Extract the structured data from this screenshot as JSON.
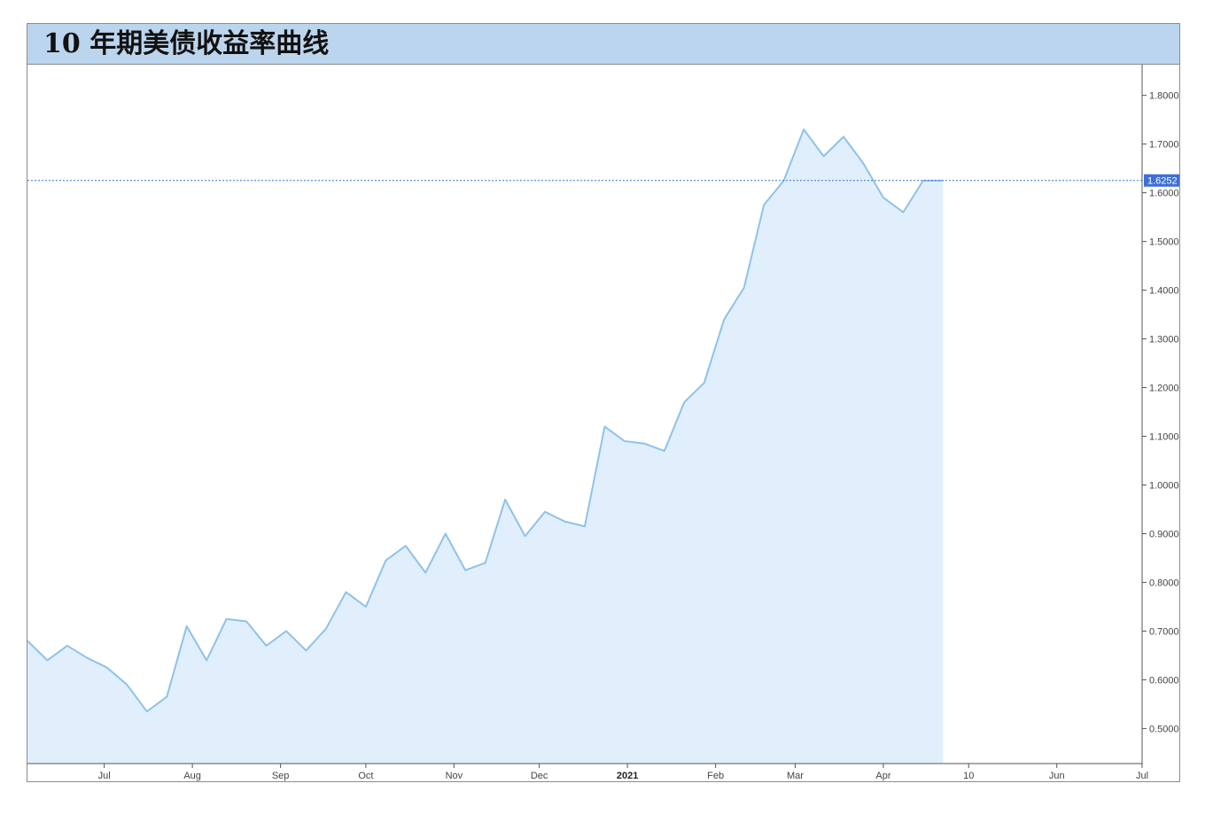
{
  "chart_data": {
    "type": "area",
    "title": "10 年期美债收益率曲线",
    "xlabel": "",
    "ylabel": "",
    "x_ticks": [
      {
        "label": "Jul",
        "date": "2020-07-01",
        "bold": false
      },
      {
        "label": "Aug",
        "date": "2020-08-01",
        "bold": false
      },
      {
        "label": "Sep",
        "date": "2020-09-01",
        "bold": false
      },
      {
        "label": "Oct",
        "date": "2020-10-01",
        "bold": false
      },
      {
        "label": "Nov",
        "date": "2020-11-01",
        "bold": false
      },
      {
        "label": "Dec",
        "date": "2020-12-01",
        "bold": false
      },
      {
        "label": "2021",
        "date": "2021-01-01",
        "bold": true
      },
      {
        "label": "Feb",
        "date": "2021-02-01",
        "bold": false
      },
      {
        "label": "Mar",
        "date": "2021-03-01",
        "bold": false
      },
      {
        "label": "Apr",
        "date": "2021-04-01",
        "bold": false
      },
      {
        "label": "10",
        "date": "2021-05-01",
        "bold": false
      },
      {
        "label": "Jun",
        "date": "2021-06-01",
        "bold": false
      },
      {
        "label": "Jul",
        "date": "2021-07-01",
        "bold": false
      }
    ],
    "y_ticks": [
      {
        "label": "1.8000",
        "value": 1.8
      },
      {
        "label": "1.7000",
        "value": 1.7
      },
      {
        "label": "1.6000",
        "value": 1.6
      },
      {
        "label": "1.5000",
        "value": 1.5
      },
      {
        "label": "1.4000",
        "value": 1.4
      },
      {
        "label": "1.3000",
        "value": 1.3
      },
      {
        "label": "1.2000",
        "value": 1.2
      },
      {
        "label": "1.1000",
        "value": 1.1
      },
      {
        "label": "1.0000",
        "value": 1.0
      },
      {
        "label": "0.9000",
        "value": 0.9
      },
      {
        "label": "0.8000",
        "value": 0.8
      },
      {
        "label": "0.7000",
        "value": 0.7
      },
      {
        "label": "0.6000",
        "value": 0.6
      },
      {
        "label": "0.5000",
        "value": 0.5
      }
    ],
    "xlim": [
      "2020-06-04",
      "2021-07-01"
    ],
    "ylim": [
      0.428,
      1.863
    ],
    "grid": false,
    "last_value": 1.6252,
    "last_value_label": "1.6252",
    "series": [
      {
        "name": "",
        "x": [
          "2020-06-04",
          "2020-06-11",
          "2020-06-18",
          "2020-06-25",
          "2020-07-02",
          "2020-07-09",
          "2020-07-16",
          "2020-07-23",
          "2020-07-30",
          "2020-08-06",
          "2020-08-13",
          "2020-08-20",
          "2020-08-27",
          "2020-09-03",
          "2020-09-10",
          "2020-09-17",
          "2020-09-24",
          "2020-10-01",
          "2020-10-08",
          "2020-10-15",
          "2020-10-22",
          "2020-10-29",
          "2020-11-05",
          "2020-11-12",
          "2020-11-19",
          "2020-11-26",
          "2020-12-03",
          "2020-12-10",
          "2020-12-17",
          "2020-12-24",
          "2020-12-31",
          "2021-01-07",
          "2021-01-14",
          "2021-01-21",
          "2021-01-28",
          "2021-02-04",
          "2021-02-11",
          "2021-02-18",
          "2021-02-25",
          "2021-03-04",
          "2021-03-11",
          "2021-03-18",
          "2021-03-25",
          "2021-04-01",
          "2021-04-08",
          "2021-04-15",
          "2021-04-22"
        ],
        "y": [
          0.68,
          0.64,
          0.67,
          0.645,
          0.625,
          0.59,
          0.535,
          0.565,
          0.71,
          0.64,
          0.725,
          0.72,
          0.67,
          0.7,
          0.66,
          0.705,
          0.78,
          0.75,
          0.845,
          0.875,
          0.82,
          0.9,
          0.825,
          0.84,
          0.97,
          0.895,
          0.945,
          0.925,
          0.915,
          1.12,
          1.09,
          1.085,
          1.07,
          1.17,
          1.21,
          1.34,
          1.405,
          1.575,
          1.625,
          1.73,
          1.675,
          1.715,
          1.66,
          1.59,
          1.56,
          1.625,
          1.625
        ]
      }
    ],
    "colors": {
      "line": "#8fc2ea",
      "fill": "#e0effb",
      "title_bar": "#bcd5ee",
      "price_line": "#3d6fd8",
      "price_tag": "#3d6fd8"
    }
  }
}
